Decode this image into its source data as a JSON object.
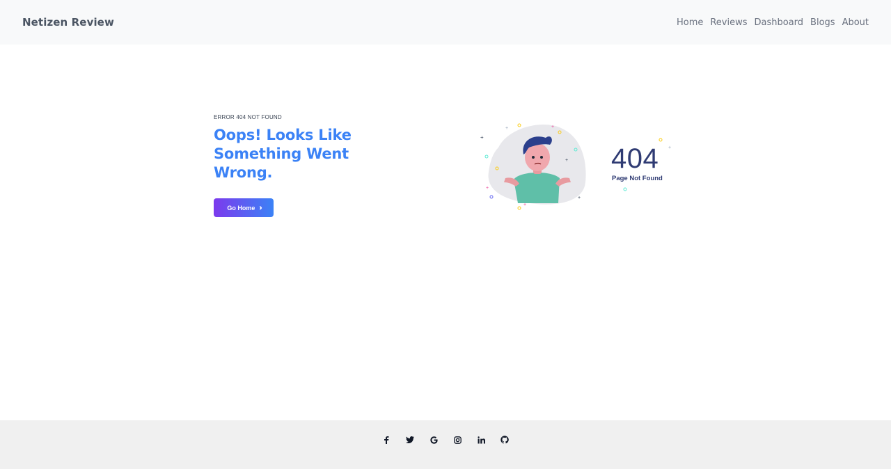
{
  "header": {
    "brand": "Netizen Review",
    "nav": [
      "Home",
      "Reviews",
      "Dashboard",
      "Blogs",
      "About"
    ]
  },
  "main": {
    "eyebrow": "ERROR 404 NOT FOUND",
    "headline": "Oops! Looks Like Something Went Wrong.",
    "button_label": "Go Home",
    "button_icon": "double-chevron-right-icon",
    "code": "404",
    "code_subtitle": "Page Not Found"
  },
  "footer": {
    "socials": [
      "facebook-icon",
      "twitter-icon",
      "google-icon",
      "instagram-icon",
      "linkedin-icon",
      "github-icon"
    ]
  },
  "colors": {
    "accent_blue": "#3b82f6",
    "accent_purple": "#7c3aed",
    "code_navy": "#2f3b73",
    "header_bg": "#f8f9fa",
    "footer_bg": "#f0f0f0"
  }
}
